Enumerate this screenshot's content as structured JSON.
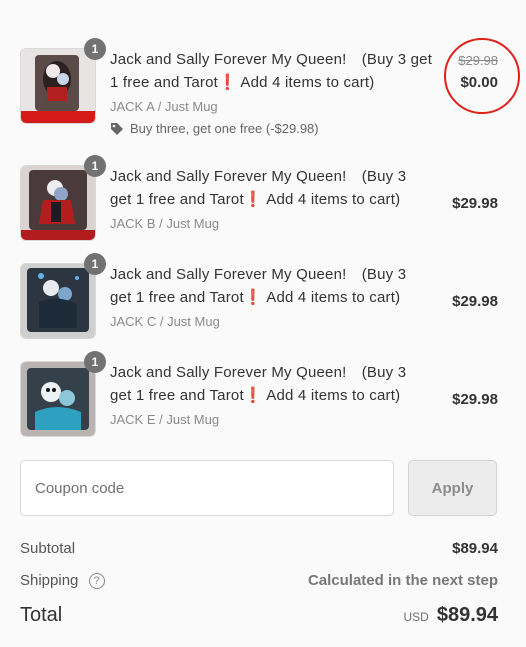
{
  "items": [
    {
      "qty": "1",
      "title": "Jack and Sally Forever My Queen!　(Buy 3 get 1 free and Tarot",
      "title_after": " Add 4 items to cart)",
      "variant": "JACK A / Just Mug",
      "discount": "Buy three, get one free (-$29.98)",
      "original_price": "$29.98",
      "price": "$0.00",
      "image": "mug-jack-sally-red"
    },
    {
      "qty": "1",
      "title": "Jack and Sally Forever My Queen!　(Buy 3 get 1 free and Tarot",
      "title_after": " Add 4 items to cart)",
      "variant": "JACK B / Just Mug",
      "price": "$29.98",
      "image": "mug-jack-sally-kiss"
    },
    {
      "qty": "1",
      "title": "Jack and Sally Forever My Queen!　(Buy 3 get 1 free and Tarot",
      "title_after": " Add 4 items to cart)",
      "variant": "JACK C / Just Mug",
      "price": "$29.98",
      "image": "mug-jack-sally-night"
    },
    {
      "qty": "1",
      "title": "Jack and Sally Forever My Queen!　(Buy 3 get 1 free and Tarot",
      "title_after": " Add 4 items to cart)",
      "variant": "JACK E / Just Mug",
      "price": "$29.98",
      "image": "mug-jack-sally-blue"
    }
  ],
  "coupon": {
    "placeholder": "Coupon code",
    "apply_label": "Apply"
  },
  "summary": {
    "subtotal_label": "Subtotal",
    "subtotal_value": "$89.94",
    "shipping_label": "Shipping",
    "shipping_help": "?",
    "shipping_value": "Calculated in the next step",
    "total_label": "Total",
    "currency": "USD",
    "total_value": "$89.94"
  },
  "colors": {
    "highlight_circle": "#e0211b",
    "exclamation": "#e01b24"
  }
}
